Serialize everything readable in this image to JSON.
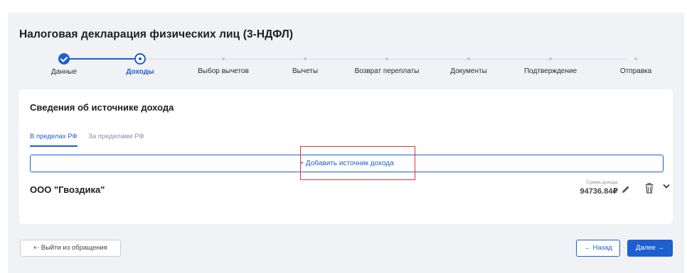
{
  "page": {
    "title": "Налоговая декларация физических лиц (3-НДФЛ)"
  },
  "stepper": {
    "steps": [
      {
        "label": "Данные",
        "state": "done"
      },
      {
        "label": "Доходы",
        "state": "current"
      },
      {
        "label": "Выбор вычетов",
        "state": "pending"
      },
      {
        "label": "Вычеты",
        "state": "pending"
      },
      {
        "label": "Возврат переплаты",
        "state": "pending"
      },
      {
        "label": "Документы",
        "state": "pending"
      },
      {
        "label": "Подтверждение",
        "state": "pending"
      },
      {
        "label": "Отправка",
        "state": "pending"
      }
    ]
  },
  "card": {
    "title": "Сведения об источнике дохода",
    "tabs": [
      {
        "label": "В пределах РФ",
        "active": true
      },
      {
        "label": "За пределами РФ",
        "active": false
      }
    ],
    "add_source_label": "+  Добавить источник дохода",
    "source": {
      "name": "ООО \"Гвоздика\"",
      "amount_caption": "Сумма дохода",
      "amount": "94736.84₽"
    }
  },
  "footer": {
    "exit_label": "⇠  Выйти из обращения",
    "back_label": "← Назад",
    "next_label": "Далее →"
  },
  "colors": {
    "accent": "#1f5ecf",
    "highlight": "#e03434",
    "background": "#f1f2f6"
  },
  "icons": [
    "check-icon",
    "pencil-icon",
    "trash-icon",
    "chevron-down-icon",
    "exit-icon"
  ]
}
